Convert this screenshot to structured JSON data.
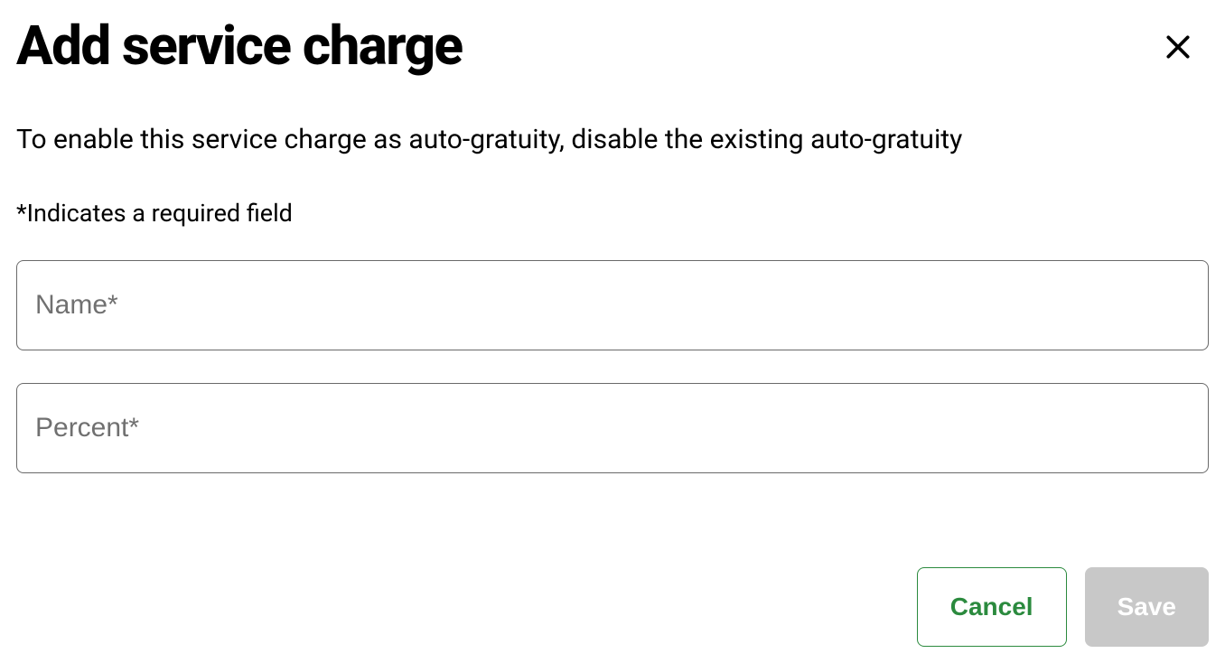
{
  "dialog": {
    "title": "Add service charge",
    "description": "To enable this service charge as auto-gratuity, disable the existing auto-gratuity",
    "required_hint": "*Indicates a required field",
    "fields": {
      "name": {
        "placeholder": "Name*",
        "value": ""
      },
      "percent": {
        "placeholder": "Percent*",
        "value": ""
      }
    },
    "buttons": {
      "cancel": "Cancel",
      "save": "Save"
    }
  }
}
